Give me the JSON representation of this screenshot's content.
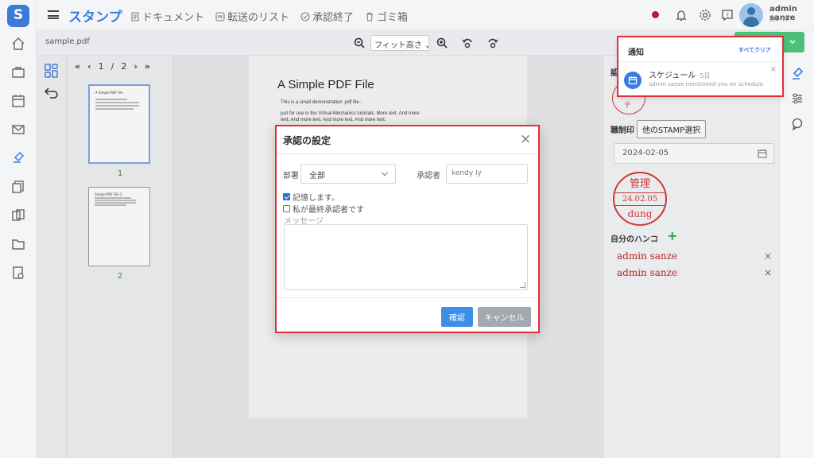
{
  "app": {
    "title": "スタンプ",
    "nav": [
      {
        "label": "ドキュメント",
        "icon": "document-icon"
      },
      {
        "label": "転送のリスト",
        "icon": "transfer-list-icon"
      },
      {
        "label": "承認終了",
        "icon": "check-circle-icon"
      },
      {
        "label": "ゴミ箱",
        "icon": "trash-icon"
      }
    ],
    "user": {
      "name": "admin sanze",
      "lang": "EN -IT"
    }
  },
  "toolbar": {
    "filename": "sample.pdf",
    "zoom_selected": "フィット高さ"
  },
  "thumbnails": {
    "pager": {
      "first": "«",
      "prev": "‹",
      "current": "1",
      "sep": "/",
      "total": "2",
      "next": "›",
      "last": "»"
    },
    "pages": [
      {
        "num": "1",
        "title": "A Simple PDF File",
        "selected": true
      },
      {
        "num": "2",
        "title": "Simple PDF File 2",
        "selected": false
      }
    ]
  },
  "document": {
    "title": "A Simple PDF File",
    "lines": [
      "This is a small demonstration .pdf file -",
      "just for use in the Virtual Mechanics tutorials. More text. And more",
      "text. And more text. And more text. And more text."
    ]
  },
  "modal": {
    "title": "承認の設定",
    "close": "×",
    "dept_label": "部署",
    "dept_value": "全部",
    "approver_label": "承認者",
    "approver_value": "kendy ly",
    "remember_label": "記憶します。",
    "remember_checked": true,
    "final_label": "私が最終承認者です",
    "final_checked": false,
    "message_label": "メッセージ",
    "message_value": "",
    "confirm": "確認",
    "cancel": "キャンセル"
  },
  "notification": {
    "title": "通知",
    "clear_all": "すべてクリア",
    "close": "×",
    "items": [
      {
        "heading": "スケジュール",
        "age": "5日",
        "message": "admin sanze mentioned you on schedule"
      }
    ]
  },
  "right_panel": {
    "section_cut": "認",
    "stamp_label": "職制印",
    "other_stamp_button": "他のSTAMP選択",
    "date": "2024-02-05",
    "stamp": {
      "top": "管理",
      "date": "24.02.05",
      "bottom": "dung"
    },
    "partial_stamp_text": "テ",
    "my_hanko_label": "自分のハンコ",
    "add_icon": "+",
    "hankos": [
      "admin sanze",
      "admin sanze"
    ],
    "remove_icon": "×"
  },
  "colors": {
    "brand": "#3c7be0",
    "highlight_border": "#e0303a",
    "stamp_red": "#d63333",
    "confirm_blue": "#3c8ee8",
    "cancel_gray": "#a3a9b0",
    "add_green": "#2aa84a"
  }
}
